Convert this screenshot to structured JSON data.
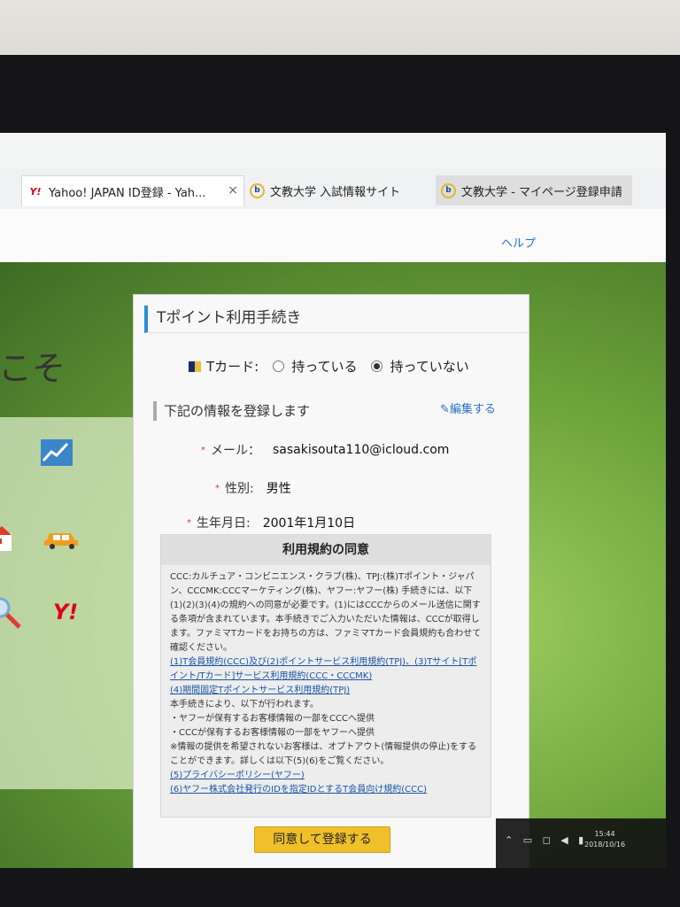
{
  "browser": {
    "tabs": [
      {
        "label": "Yahoo! JAPAN ID登録 - Yah...",
        "icon": "yahoo-icon",
        "active": true,
        "close": "×"
      },
      {
        "label": "文教大学 入試情報サイト",
        "icon": "bunkyo-icon",
        "active": false
      },
      {
        "label": "文教大学 - マイページ登録申請",
        "icon": "bunkyo-icon",
        "active": false
      }
    ],
    "help_link": "ヘルプ"
  },
  "left_panel": {
    "welcome_text": "こそ",
    "icons": [
      "chart-icon",
      "house-icon",
      "car-icon",
      "search-icon",
      "yahoo-icon"
    ],
    "yahoo_mark": "Y!"
  },
  "form": {
    "title": "Tポイント利用手続き",
    "tcard": {
      "label": "Tカード:",
      "options": [
        "持っている",
        "持っていない"
      ],
      "selected": "持っていない"
    },
    "section_title": "下記の情報を登録します",
    "edit_link": "編集する",
    "fields": {
      "email": {
        "label": "メール：",
        "value": "sasakisouta110@icloud.com"
      },
      "gender": {
        "label": "性別:",
        "value": "男性"
      },
      "birthday": {
        "label": "生年月日:",
        "value": "2001年1月10日"
      }
    },
    "terms": {
      "heading": "利用規約の同意",
      "body": "CCC:カルチュア・コンビニエンス・クラブ(株)、TPJ:(株)Tポイント・ジャパン、CCCMK:CCCマーケティング(株)、ヤフー:ヤフー(株) 手続きには、以下(1)(2)(3)(4)の規約への同意が必要です。(1)にはCCCからのメール送信に関する条項が含まれています。本手続きでご入力いただいた情報は、CCCが取得します。ファミマTカードをお持ちの方は、ファミマTカード会員規約も合わせて確認ください。",
      "link1": "(1)T会員規約(CCC)及び(2)ポイントサービス利用規約(TPJ)、(3)Tサイト[Tポイント/Tカード]サービス利用規約(CCC・CCCMK)",
      "link2": "(4)期間固定Tポイントサービス利用規約(TPJ)",
      "body2": "本手続きにより、以下が行われます。",
      "bullet1": "・ヤフーが保有するお客様情報の一部をCCCへ提供",
      "bullet2": "・CCCが保有するお客様情報の一部をヤフーへ提供",
      "body3": "※情報の提供を希望されないお客様は、オプトアウト(情報提供の停止)をすることができます。詳しくは以下(5)(6)をご覧ください。",
      "link3": "(5)プライバシーポリシー(ヤフー)",
      "link4": "(6)ヤフー株式会社発行のIDを指定IDとするT会員向け規約(CCC)"
    },
    "submit": "同意して登録する"
  },
  "taskbar": {
    "time": "15:44",
    "date": "2018/10/16"
  }
}
